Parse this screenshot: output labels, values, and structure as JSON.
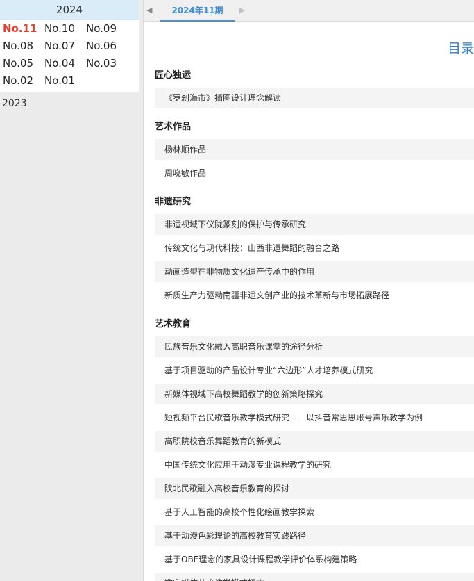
{
  "sidebar": {
    "year_current": "2024",
    "issues": [
      "No.11",
      "No.10",
      "No.09",
      "No.08",
      "No.07",
      "No.06",
      "No.05",
      "No.04",
      "No.03",
      "No.02",
      "No.01"
    ],
    "year_other": "2023"
  },
  "tabbar": {
    "active_tab": "2024年11期"
  },
  "toc": {
    "title": "目录",
    "sections": [
      {
        "title": "匠心独运",
        "items": [
          "《罗刹海市》插图设计理念解读"
        ]
      },
      {
        "title": "艺术作品",
        "items": [
          "杨林顺作品",
          "周晓敏作品"
        ]
      },
      {
        "title": "非遗研究",
        "items": [
          "非遗视域下仪陇篆刻的保护与传承研究",
          "传统文化与现代科技：山西非遗舞蹈的融合之路",
          "动画造型在非物质文化遗产传承中的作用",
          "新质生产力驱动南疆非遗文创产业的技术革新与市场拓展路径"
        ]
      },
      {
        "title": "艺术教育",
        "items": [
          "民族音乐文化融入高职音乐课堂的途径分析",
          "基于项目驱动的产品设计专业“六边形”人才培养模式研究",
          "新媒体视域下高校舞蹈教学的创新策略探究",
          "短视频平台民歌音乐教学模式研究——以抖音常思思账号声乐教学为例",
          "高职院校音乐舞蹈教育的新模式",
          "中国传统文化应用于动漫专业课程教学的研究",
          "陕北民歌融入高校音乐教育的探讨",
          "基于人工智能的高校个性化绘画教学探索",
          "基于动漫色彩理论的高校教育实践路径",
          "基于OBE理念的家具设计课程教学评价体系构建策略",
          "数字媒体艺术教学模式探索"
        ]
      }
    ]
  }
}
